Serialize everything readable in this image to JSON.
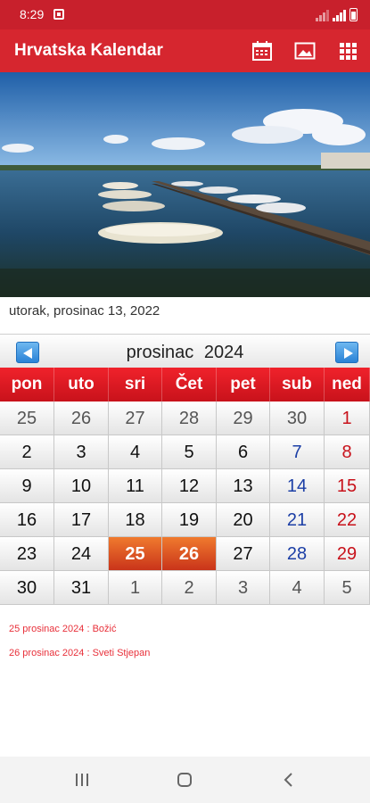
{
  "status_bar": {
    "time": "8:29"
  },
  "app_bar": {
    "title": "Hrvatska Kalendar",
    "actions": [
      "calendar-icon",
      "image-icon",
      "grid-icon"
    ]
  },
  "selected_date_text": "utorak, prosinac 13, 2022",
  "calendar": {
    "month": "prosinac",
    "year": "2024",
    "weekdays": [
      "pon",
      "uto",
      "sri",
      "Čet",
      "pet",
      "sub",
      "ned"
    ],
    "weeks": [
      [
        {
          "d": "25",
          "t": "other"
        },
        {
          "d": "26",
          "t": "other"
        },
        {
          "d": "27",
          "t": "other"
        },
        {
          "d": "28",
          "t": "other"
        },
        {
          "d": "29",
          "t": "other"
        },
        {
          "d": "30",
          "t": "other"
        },
        {
          "d": "1",
          "t": "sun"
        }
      ],
      [
        {
          "d": "2",
          "t": "cur"
        },
        {
          "d": "3",
          "t": "cur"
        },
        {
          "d": "4",
          "t": "cur"
        },
        {
          "d": "5",
          "t": "cur"
        },
        {
          "d": "6",
          "t": "cur"
        },
        {
          "d": "7",
          "t": "sat"
        },
        {
          "d": "8",
          "t": "sun"
        }
      ],
      [
        {
          "d": "9",
          "t": "cur"
        },
        {
          "d": "10",
          "t": "cur"
        },
        {
          "d": "11",
          "t": "cur"
        },
        {
          "d": "12",
          "t": "cur"
        },
        {
          "d": "13",
          "t": "cur"
        },
        {
          "d": "14",
          "t": "sat"
        },
        {
          "d": "15",
          "t": "sun"
        }
      ],
      [
        {
          "d": "16",
          "t": "cur"
        },
        {
          "d": "17",
          "t": "cur"
        },
        {
          "d": "18",
          "t": "cur"
        },
        {
          "d": "19",
          "t": "cur"
        },
        {
          "d": "20",
          "t": "cur"
        },
        {
          "d": "21",
          "t": "sat"
        },
        {
          "d": "22",
          "t": "sun"
        }
      ],
      [
        {
          "d": "23",
          "t": "cur"
        },
        {
          "d": "24",
          "t": "cur"
        },
        {
          "d": "25",
          "t": "holiday"
        },
        {
          "d": "26",
          "t": "holiday"
        },
        {
          "d": "27",
          "t": "cur"
        },
        {
          "d": "28",
          "t": "sat"
        },
        {
          "d": "29",
          "t": "sun"
        }
      ],
      [
        {
          "d": "30",
          "t": "cur"
        },
        {
          "d": "31",
          "t": "cur"
        },
        {
          "d": "1",
          "t": "other"
        },
        {
          "d": "2",
          "t": "other"
        },
        {
          "d": "3",
          "t": "other"
        },
        {
          "d": "4",
          "t": "other"
        },
        {
          "d": "5",
          "t": "other"
        }
      ]
    ]
  },
  "events": [
    "25 prosinac 2024 : Božić",
    "26 prosinac 2024 : Sveti Stjepan"
  ],
  "colors": {
    "primary": "#d6262f",
    "status_bar": "#c8202c",
    "holiday": "#e0561f",
    "saturday": "#1c3fa6",
    "sunday": "#c8121b"
  }
}
